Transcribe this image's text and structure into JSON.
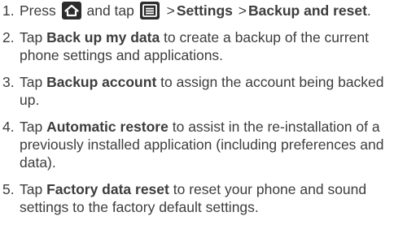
{
  "steps": [
    {
      "number": "1.",
      "text_a": "Press",
      "text_b": "and tap",
      "gt1": ">",
      "bold_settings": "Settings",
      "gt2": ">",
      "bold_backup": "Backup and reset",
      "end": ".",
      "icons": [
        "home-icon",
        "menu-icon"
      ]
    },
    {
      "number": "2.",
      "pre": "Tap",
      "bold": "Back up my data",
      "post": "to create a backup of the current phone settings and applications."
    },
    {
      "number": "3.",
      "pre": "Tap",
      "bold": "Backup account",
      "post": "to assign the account being backed up."
    },
    {
      "number": "4.",
      "pre": "Tap",
      "bold": "Automatic restore",
      "post": "to assist in the re-installation of a previously installed application (including preferences and data)."
    },
    {
      "number": "5.",
      "pre": "Tap",
      "bold": "Factory data reset",
      "post": "to reset your phone and sound settings to the factory default settings."
    }
  ],
  "colors": {
    "text": "#3d3d3d",
    "icon_bg": "#2c2c2c",
    "icon_fg": "#ffffff"
  }
}
